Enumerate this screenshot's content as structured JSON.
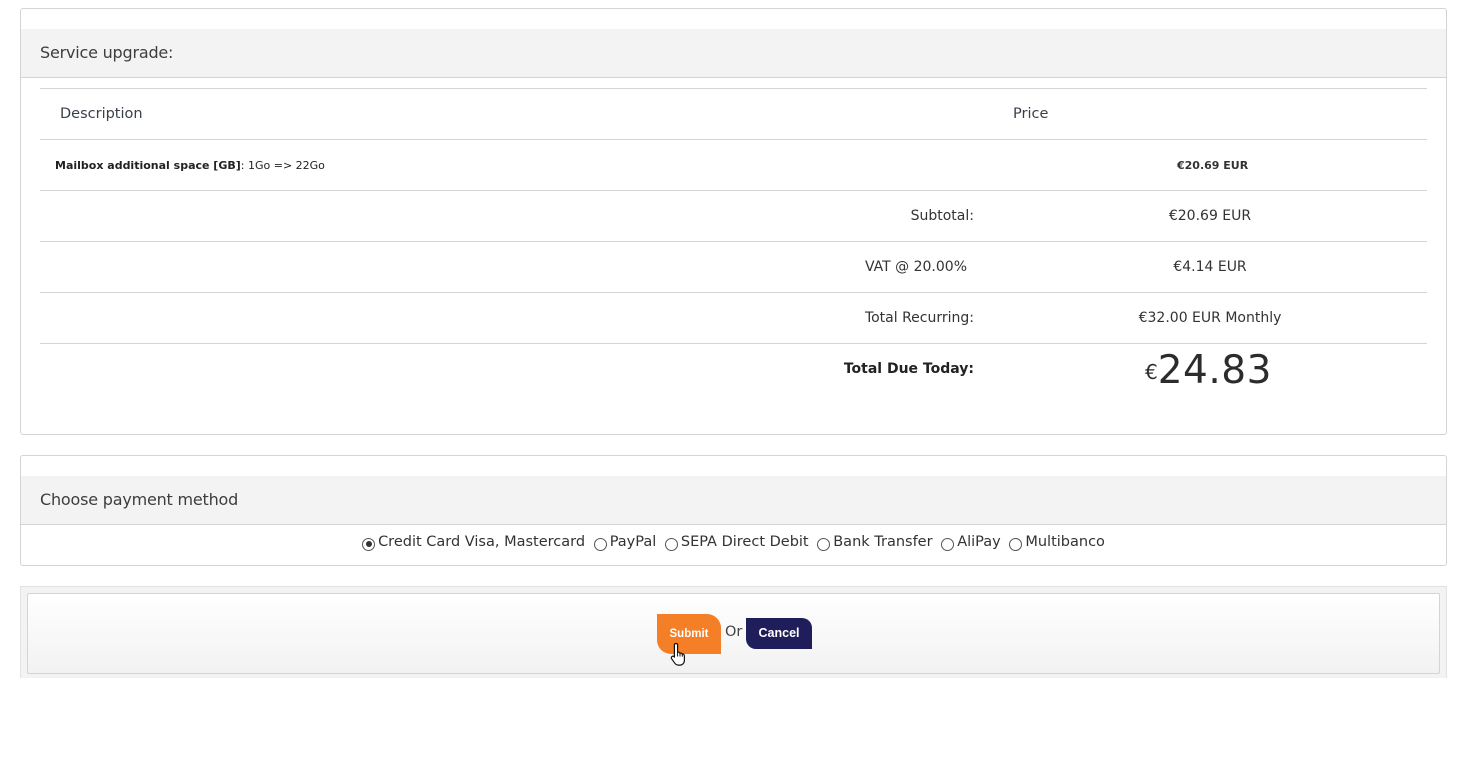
{
  "upgrade": {
    "title": "Service upgrade:",
    "columns": {
      "description": "Description",
      "price": "Price"
    },
    "item": {
      "name": "Mailbox additional space [GB]",
      "detail": ": 1Go => 22Go",
      "price": "€20.69 EUR"
    },
    "summary": {
      "subtotal_label": "Subtotal:",
      "subtotal_value": "€20.69 EUR",
      "vat_label": "VAT @ 20.00%",
      "vat_value": "€4.14 EUR",
      "recurring_label": "Total Recurring:",
      "recurring_value": "€32.00 EUR Monthly",
      "due_label": "Total Due Today:",
      "due_currency": "€",
      "due_amount": "24.83"
    }
  },
  "payment": {
    "title": "Choose payment method",
    "options": [
      {
        "label": "Credit Card Visa, Mastercard",
        "selected": true
      },
      {
        "label": "PayPal",
        "selected": false
      },
      {
        "label": "SEPA Direct Debit",
        "selected": false
      },
      {
        "label": "Bank Transfer",
        "selected": false
      },
      {
        "label": "AliPay",
        "selected": false
      },
      {
        "label": "Multibanco",
        "selected": false
      }
    ]
  },
  "actions": {
    "submit_label": "Submit",
    "or_text": "Or",
    "cancel_label": "Cancel"
  },
  "colors": {
    "submit": "#f47f27",
    "cancel": "#1f1e5a"
  },
  "icons": {
    "cursor": "hand-pointer-icon"
  }
}
